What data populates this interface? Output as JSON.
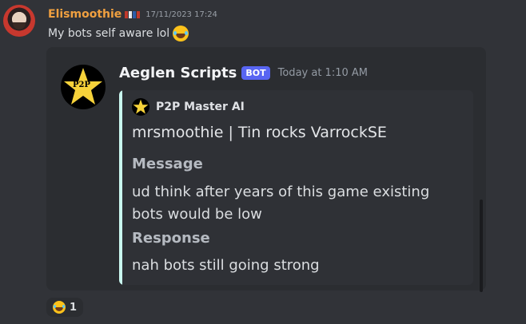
{
  "message": {
    "username": "Elismoothie",
    "timestamp": "17/11/2023 17:24",
    "text": "My bots self aware lol",
    "flag_colors": [
      "#c0392b",
      "#e8e8e8",
      "#2c5ca8",
      "#c0392b"
    ]
  },
  "bot_message": {
    "name": "Aeglen Scripts",
    "badge": "BOT",
    "time": "Today at 1:10 AM",
    "avatar_label": "P2P",
    "embed": {
      "accent_color": "#c9f7ef",
      "author": "P2P Master AI",
      "title": "mrsmoothie | Tin rocks VarrockSE",
      "fields": [
        {
          "name": "Message",
          "value": "ud think after years of this game existing bots would be low"
        },
        {
          "name": "Response",
          "value": "nah bots still going strong"
        }
      ]
    }
  },
  "reaction": {
    "icon": "laughing-emoji",
    "count": "1"
  },
  "colors": {
    "background": "#313338",
    "username": "#f0a040",
    "badge": "#5865f2"
  }
}
